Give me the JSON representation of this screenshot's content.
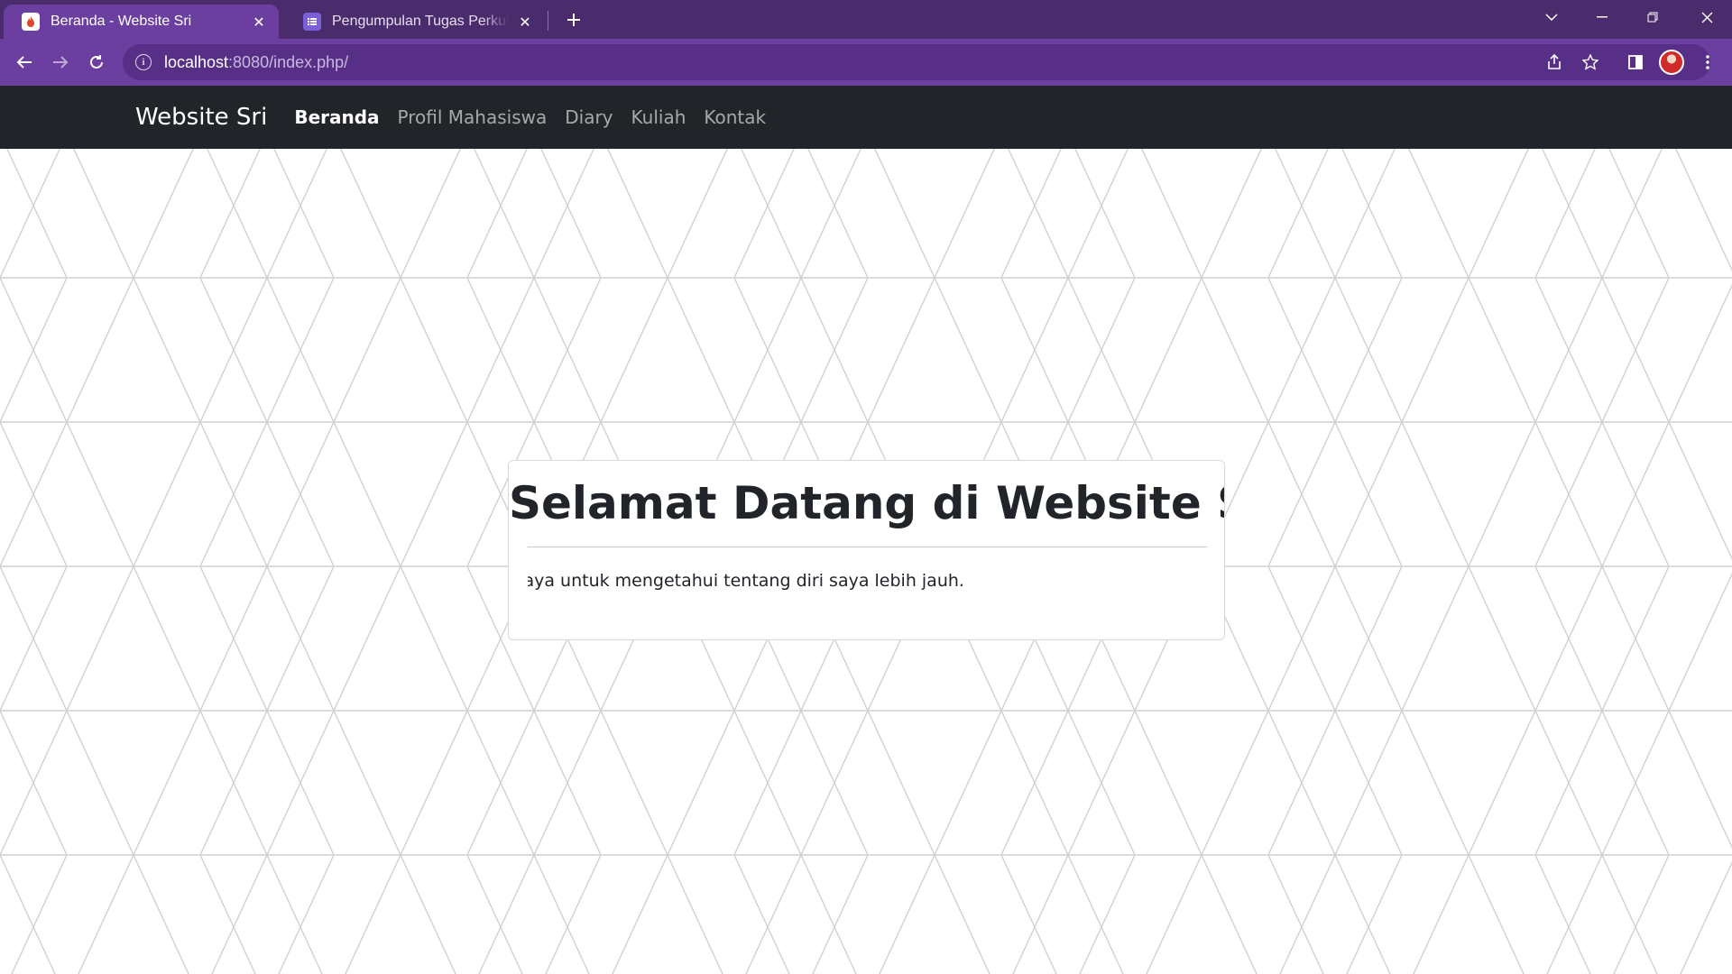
{
  "browser": {
    "tabs": [
      {
        "title": "Beranda - Website Sri",
        "active": true,
        "icon": "flame-icon"
      },
      {
        "title": "Pengumpulan Tugas Perkuliahan",
        "active": false,
        "icon": "list-icon"
      }
    ],
    "address_bar": {
      "host": "localhost",
      "path": ":8080/index.php/"
    }
  },
  "site": {
    "brand": "Website Sri",
    "nav": [
      {
        "label": "Beranda",
        "active": true
      },
      {
        "label": "Profil Mahasiswa",
        "active": false
      },
      {
        "label": "Diary",
        "active": false
      },
      {
        "label": "Kuliah",
        "active": false
      },
      {
        "label": "Kontak",
        "active": false
      }
    ],
    "card": {
      "heading": "Selamat Datang di Website Saya",
      "marquee_text": "Silahkan kunjungi website saya untuk mengetahui tentang diri saya lebih jauh."
    }
  },
  "colors": {
    "tabstrip": "#4a2b6b",
    "toolbar": "#6b3fa0",
    "site_navbar": "#212529",
    "pattern_lines": "#d0d0d0"
  }
}
